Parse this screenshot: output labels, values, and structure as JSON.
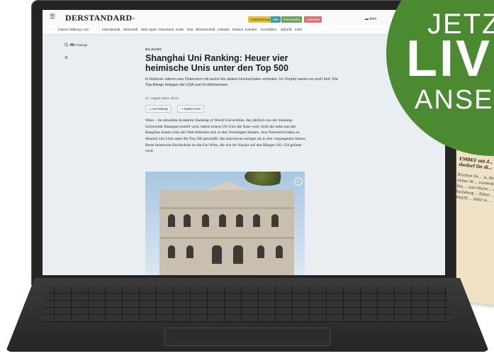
{
  "badge": {
    "line1": "JETZ",
    "line2": "LIV",
    "line3": "ANSEH"
  },
  "newspaper": {
    "headline": "EMBEF mit d... undheitsvers... ebedarf für di...",
    "body": "Brichten für ... ie, die Medizin ... acht stehen 30 ... wameedizin ... erfügung. Das ... ssen Wache ... sart 1,26 l ... Sachehorg ... flehen ... der eittern, d ... MedAT ... dafür iu. ..."
  },
  "site": {
    "logo": "DERSTANDARD",
    "logo_caret": "⌄",
    "menu_icon": "☰",
    "pills": [
      "Unterstützung",
      "Abo",
      "Immosuche",
      "Jobsuche"
    ],
    "account": "▬ Anm",
    "nav": [
      "Inland • Bildung • Uni",
      "International",
      "Wirtschaft",
      "Web",
      "Sport",
      "Panorama",
      "Kultur",
      "Etat",
      "Wissenschaft",
      "Lifestyle",
      "Diskurs",
      "Karriere",
      "Immobilien",
      "Zukunft",
      "mehr"
    ]
  },
  "article": {
    "postings_count": "48",
    "postings_label": "Postings",
    "kicker": "BILDUNG",
    "headline": "Shanghai Uni Ranking: Heuer vier heimische Unis unter den Top 500",
    "lead": "In früheren Jahren war Österreich mit sechs bis sieben Hochschulen vertreten. Im Vorjahr waren es noch fünf. Die Top-Ränge belegen die USA und Großbritannien",
    "date": "17. August 2024, 09:41",
    "postings_button": "48 Postings",
    "later_button": "Später lesen",
    "body": "Wien – Im aktuellen Academic Ranking of World Universities, das jährlich von der Jiaotong-Universität Shanghai erstellt wird, haben erneut US-Unis die Nase vorn: Acht der zehn laut der Rangliste besten Unis der Welt befinden sich in den Vereinigten Staaten. Aus Österreich haben es diesmal vier Unis unter die Top 500 geschafft, das sind etwas weniger als in den vergangenen Jahren. Beste heimische Hochschule ist die Uni Wien, die wie im Vorjahr auf den Rängen 101-150 gelistet wird."
  },
  "icons": {
    "share": "share-icon",
    "comment": "comment-icon",
    "lens": "lens-icon"
  }
}
